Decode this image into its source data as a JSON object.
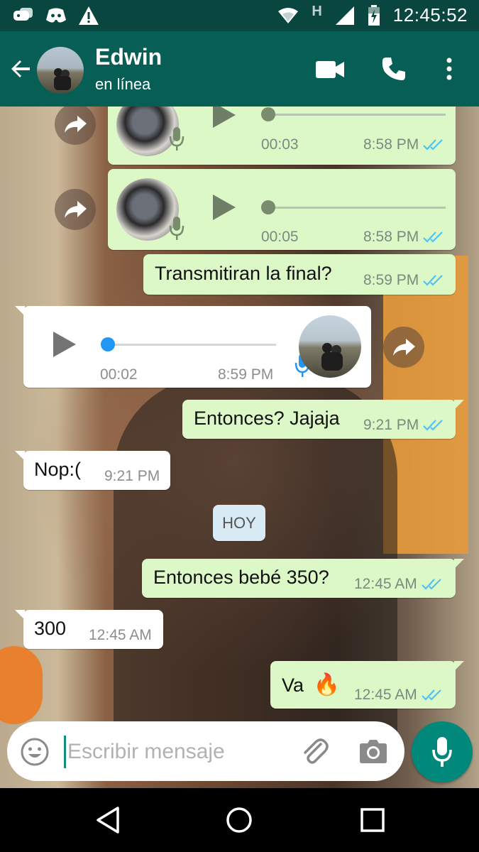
{
  "status_bar": {
    "time": "12:45:52",
    "network_label": "H",
    "icons": [
      "gamepad-icon",
      "discord-icon",
      "warning-icon",
      "wifi-icon",
      "signal-icon",
      "battery-charging-icon"
    ]
  },
  "header": {
    "contact_name": "Edwin",
    "contact_status": "en línea",
    "actions": [
      "video-call-icon",
      "phone-icon",
      "more-vert-icon"
    ]
  },
  "messages": [
    {
      "type": "voice",
      "direction": "outgoing",
      "duration": "00:03",
      "time": "8:58 PM",
      "read": true,
      "progress": 0
    },
    {
      "type": "voice",
      "direction": "outgoing",
      "duration": "00:05",
      "time": "8:58 PM",
      "read": true,
      "progress": 0
    },
    {
      "type": "text",
      "direction": "outgoing",
      "text": "Transmitiran la final?",
      "time": "8:59 PM",
      "read": true
    },
    {
      "type": "voice",
      "direction": "incoming",
      "duration": "00:02",
      "time": "8:59 PM",
      "progress": 0
    },
    {
      "type": "text",
      "direction": "outgoing",
      "text": "Entonces? Jajaja",
      "time": "9:21 PM",
      "read": true
    },
    {
      "type": "text",
      "direction": "incoming",
      "text": "Nop:(",
      "time": "9:21 PM"
    },
    {
      "type": "date",
      "text": "HOY"
    },
    {
      "type": "text",
      "direction": "outgoing",
      "text": "Entonces bebé 350?",
      "time": "12:45 AM",
      "read": true
    },
    {
      "type": "text",
      "direction": "incoming",
      "text": "300",
      "time": "12:45 AM"
    },
    {
      "type": "text",
      "direction": "outgoing",
      "text": "Va",
      "emoji": "🔥",
      "time": "12:45 AM",
      "read": true
    }
  ],
  "composer": {
    "placeholder": "Escribir mensaje",
    "value": ""
  },
  "colors": {
    "header": "#075e54",
    "status_bar": "#09463f",
    "outgoing_bubble": "#dcf8c6",
    "incoming_bubble": "#ffffff",
    "read_ticks": "#4fc3f7",
    "accent": "#00897b",
    "voice_outgoing": "#7a8c6e",
    "voice_incoming": "#2196f3"
  },
  "nav": [
    "back-nav-icon",
    "home-nav-icon",
    "recents-nav-icon"
  ]
}
